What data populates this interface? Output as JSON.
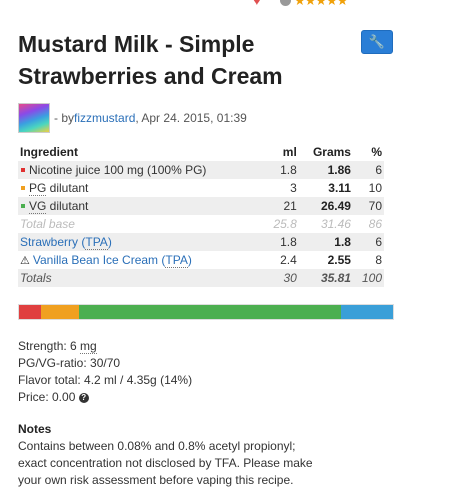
{
  "top": {
    "stars": "★★★★★"
  },
  "recipe": {
    "title": "Mustard Milk - Simple Strawberries and Cream",
    "by_prefix": " - by ",
    "author": "fizzmustard",
    "date": ", Apr 24. 2015, 01:39"
  },
  "table": {
    "headers": [
      "Ingredient",
      "ml",
      "Grams",
      "%"
    ],
    "rows": [
      {
        "name": "Nicotine juice 100 mg (100% PG)",
        "color": "#e03030",
        "ml": "1.8",
        "grams": "1.86",
        "pct": "6"
      },
      {
        "name_abbr": "PG",
        "name_rest": " dilutant",
        "color": "#f0a020",
        "ml": "3",
        "grams": "3.11",
        "pct": "10"
      },
      {
        "name_abbr": "VG",
        "name_rest": " dilutant",
        "color": "#4caf50",
        "ml": "21",
        "grams": "26.49",
        "pct": "70"
      }
    ],
    "total_base": {
      "label": "Total base",
      "ml": "25.8",
      "grams": "31.46",
      "pct": "86"
    },
    "flavors": [
      {
        "name": "Strawberry",
        "brand": "TPA",
        "ml": "1.8",
        "grams": "1.8",
        "pct": "6"
      },
      {
        "name": "Vanilla Bean Ice Cream",
        "brand": "TPA",
        "ml": "2.4",
        "grams": "2.55",
        "pct": "8"
      }
    ],
    "totals": {
      "label": "Totals",
      "ml": "30",
      "grams": "35.81",
      "pct": "100"
    }
  },
  "composition_bar": [
    {
      "name": "Nicotine",
      "pct": 6,
      "color": "#e04040"
    },
    {
      "name": "PG",
      "pct": 10,
      "color": "#f0a020"
    },
    {
      "name": "VG",
      "pct": 70,
      "color": "#4caf50"
    },
    {
      "name": "Flavor",
      "pct": 14,
      "color": "#3a9fd8"
    }
  ],
  "stats": {
    "strength_label": "Strength: 6 ",
    "strength_unit": "mg",
    "ratio": "PG/VG-ratio: 30/70",
    "flavor_total": "Flavor total: 4.2 ml / 4.35g (14%)",
    "price": "Price: 0.00 "
  },
  "notes": {
    "heading": "Notes",
    "text": "Contains between 0.08% and 0.8% acetyl propionyl; exact concentration not disclosed by TFA. Please make your own risk assessment before vaping this recipe."
  }
}
